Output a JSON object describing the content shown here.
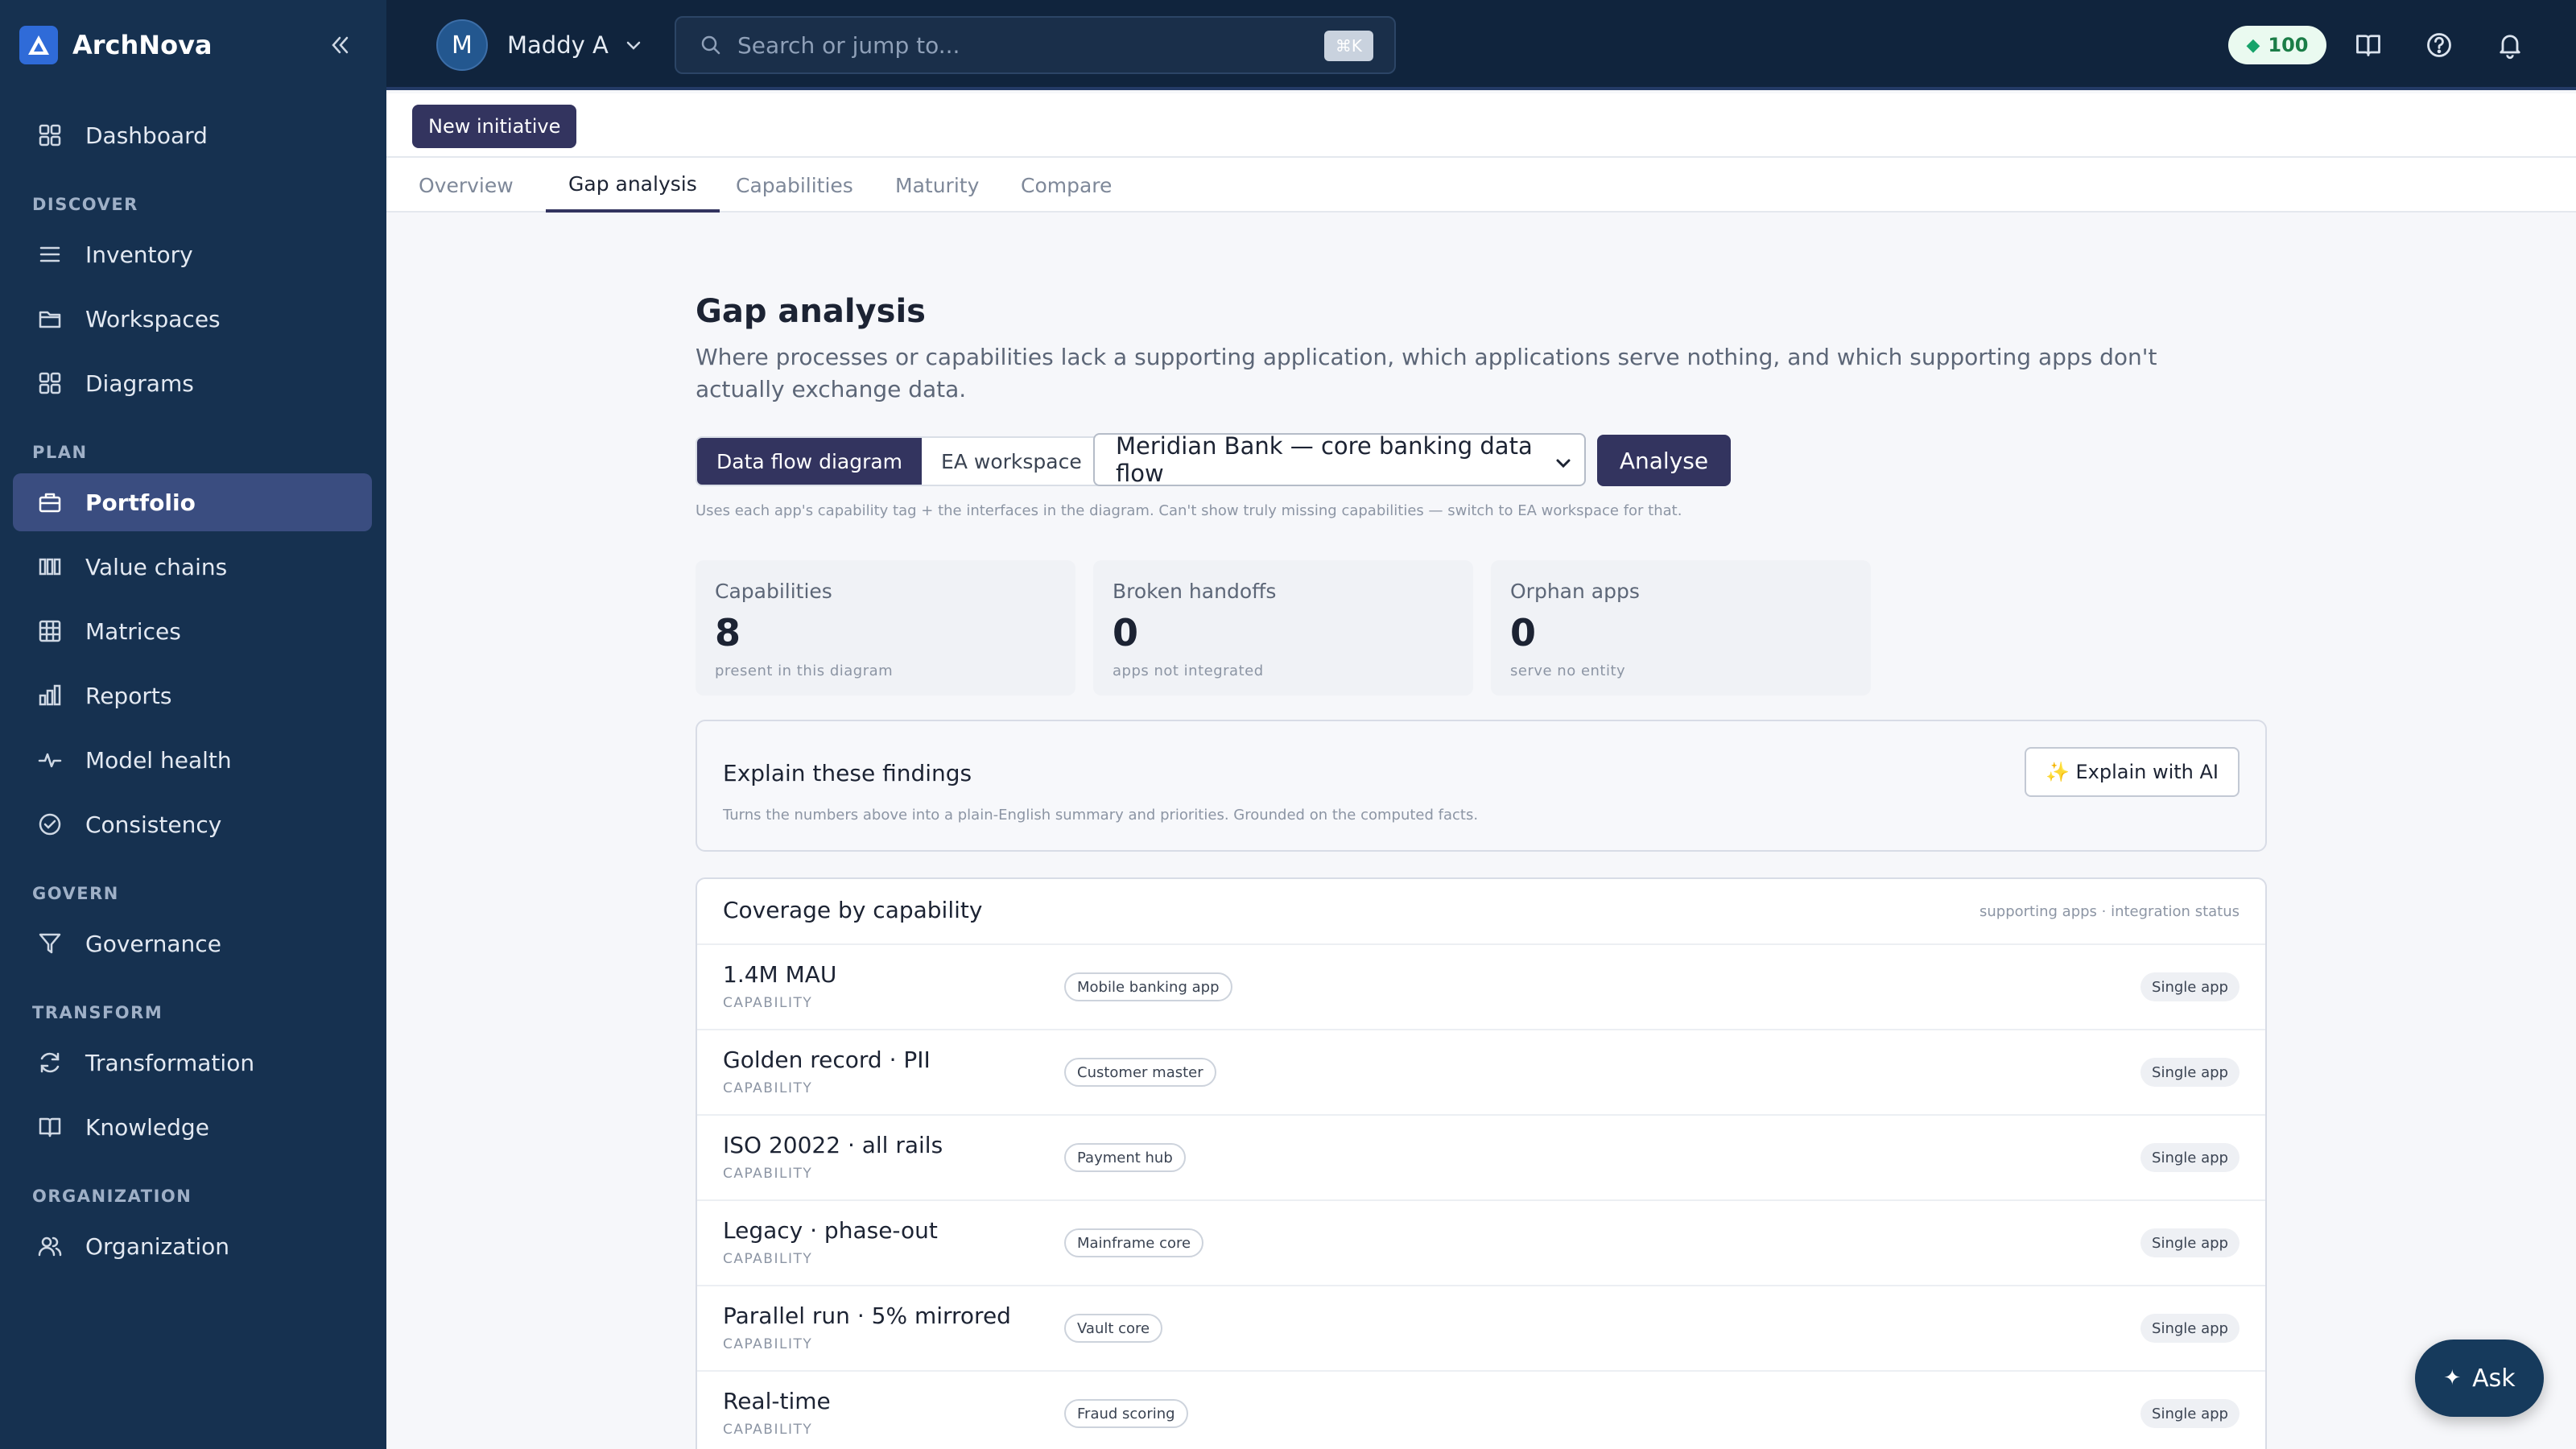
{
  "brand": {
    "name": "ArchNova"
  },
  "sidebar": {
    "dashboard": "Dashboard",
    "sections": {
      "discover": "DISCOVER",
      "plan": "PLAN",
      "govern": "GOVERN",
      "transform": "TRANSFORM",
      "organization": "ORGANIZATION"
    },
    "items": {
      "inventory": "Inventory",
      "workspaces": "Workspaces",
      "diagrams": "Diagrams",
      "portfolio": "Portfolio",
      "value_chains": "Value chains",
      "matrices": "Matrices",
      "reports": "Reports",
      "model_health": "Model health",
      "consistency": "Consistency",
      "governance": "Governance",
      "transformation": "Transformation",
      "knowledge": "Knowledge",
      "organization": "Organization"
    },
    "active": "portfolio"
  },
  "topbar": {
    "user_initial": "M",
    "user_name": "Maddy A",
    "search_placeholder": "Search or jump to...",
    "search_shortcut": "⌘K",
    "credits": "100"
  },
  "toolbar": {
    "new_initiative": "New initiative"
  },
  "tabs": [
    "Overview",
    "Gap analysis",
    "Capabilities",
    "Maturity",
    "Compare"
  ],
  "active_tab": "Gap analysis",
  "gap": {
    "title": "Gap analysis",
    "description": "Where processes or capabilities lack a supporting application, which applications serve nothing, and which supporting apps don't actually exchange data.",
    "source_options": [
      "Data flow diagram",
      "EA workspace"
    ],
    "selected_source": "Data flow diagram",
    "diagram_selected": "Meridian Bank — core banking data flow",
    "analyse_label": "Analyse",
    "hint": "Uses each app's capability tag + the interfaces in the diagram. Can't show truly missing capabilities — switch to EA workspace for that."
  },
  "stats": [
    {
      "label": "Capabilities",
      "value": "8",
      "sub": "present in this diagram"
    },
    {
      "label": "Broken handoffs",
      "value": "0",
      "sub": "apps not integrated"
    },
    {
      "label": "Orphan apps",
      "value": "0",
      "sub": "serve no entity"
    }
  ],
  "explain": {
    "title": "Explain these findings",
    "subtitle": "Turns the numbers above into a plain-English summary and priorities. Grounded on the computed facts.",
    "button": "✨ Explain with AI"
  },
  "coverage": {
    "title": "Coverage by capability",
    "hint": "supporting apps · integration status",
    "rows": [
      {
        "name": "1.4M MAU",
        "type": "CAPABILITY",
        "app": "Mobile banking app",
        "status": "Single app"
      },
      {
        "name": "Golden record · PII",
        "type": "CAPABILITY",
        "app": "Customer master",
        "status": "Single app"
      },
      {
        "name": "ISO 20022 · all rails",
        "type": "CAPABILITY",
        "app": "Payment hub",
        "status": "Single app"
      },
      {
        "name": "Legacy · phase-out",
        "type": "CAPABILITY",
        "app": "Mainframe core",
        "status": "Single app"
      },
      {
        "name": "Parallel run · 5% mirrored",
        "type": "CAPABILITY",
        "app": "Vault core",
        "status": "Single app"
      },
      {
        "name": "Real-time",
        "type": "CAPABILITY",
        "app": "Fraud scoring",
        "status": "Single app"
      }
    ]
  },
  "ask": {
    "label": "Ask"
  },
  "colors": {
    "sidebar": "#163150",
    "topbar": "#10243d",
    "accent": "#33345f",
    "credits": "#1b7d47"
  }
}
